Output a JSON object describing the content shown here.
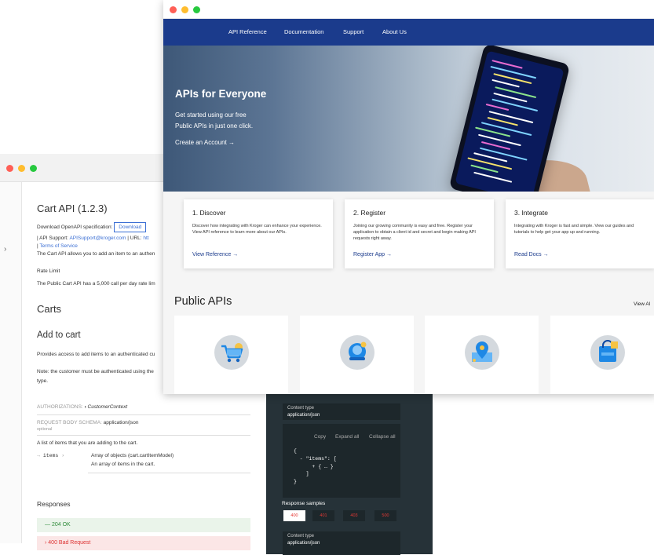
{
  "back_window": {
    "title": "Cart API (1.2.3)",
    "download_label": "Download OpenAPI specification:",
    "download_button": "Download",
    "api_support_label": "| API Support:",
    "api_support_email": "APISupport@kroger.com",
    "url_label": "| URL:",
    "url_value": "htt",
    "terms_prefix": "|",
    "terms_link": "Terms of Service",
    "intro": "The Cart API allows you to add an item to an authen",
    "rate_limit_heading": "Rate Limit",
    "rate_limit_text": "The Public Cart API has a 5,000 call per day rate lim",
    "section_carts": "Carts",
    "op_title": "Add to cart",
    "op_desc": "Provides access to add items to an authenticated cu",
    "op_note_1": "Note: the customer must be authenticated using the",
    "op_note_2": "type.",
    "authorizations_label": "AUTHORIZATIONS:",
    "authorizations_value": "CustomerContext",
    "request_body_label": "REQUEST BODY SCHEMA:",
    "request_body_type": "application/json",
    "optional_label": "optional",
    "list_desc": "A list of items that you are adding to the cart.",
    "field_name": "items",
    "field_type": "Array of objects (cart.cartItemModel)",
    "field_desc": "An array of items in the cart.",
    "responses_heading": "Responses",
    "responses": [
      {
        "label": "204 OK",
        "kind": "ok"
      },
      {
        "label": "400 Bad Request",
        "kind": "bad"
      }
    ],
    "code_panel": {
      "content_type_label": "Content type",
      "content_type_value": "application/json",
      "copy": "Copy",
      "expand_all": "Expand all",
      "collapse_all": "Collapse all",
      "code_lines": [
        "{",
        "  - \"items\": [",
        "      + { … }",
        "    ]",
        "}"
      ],
      "response_samples_label": "Response samples",
      "tabs": [
        "400",
        "401",
        "403",
        "500"
      ],
      "content_type_label_2": "Content type",
      "content_type_value_2": "application/json"
    }
  },
  "front_window": {
    "nav": [
      "API Reference",
      "Documentation",
      "Support",
      "About Us"
    ],
    "hero": {
      "heading": "APIs for Everyone",
      "sub_1": "Get started using our free",
      "sub_2": "Public APIs in just one click.",
      "cta": "Create an Account →"
    },
    "cards": [
      {
        "title": "1. Discover",
        "desc": "Discover how integrating with Kroger can enhance your experience. View API reference to learn more about our APIs.",
        "link": "View Reference →"
      },
      {
        "title": "2. Register",
        "desc": "Joining our growing community is easy and free. Register your application to obtain a client id and secret and begin making API requests right away.",
        "link": "Register App →"
      },
      {
        "title": "3. Integrate",
        "desc": "Integrating with Kroger is fast and simple. View our guides and tutorials to help get your app up and running.",
        "link": "Read Docs →"
      }
    ],
    "public_apis_heading": "Public APIs",
    "view_all": "View Al",
    "api_icons": [
      "shopping-cart-icon",
      "customer-icon",
      "location-pin-icon",
      "products-bag-icon"
    ]
  },
  "colors": {
    "nav_blue": "#1b3b8c",
    "dark_panel": "#263238",
    "ok_green": "#2e8b3a",
    "bad_red": "#d33"
  }
}
